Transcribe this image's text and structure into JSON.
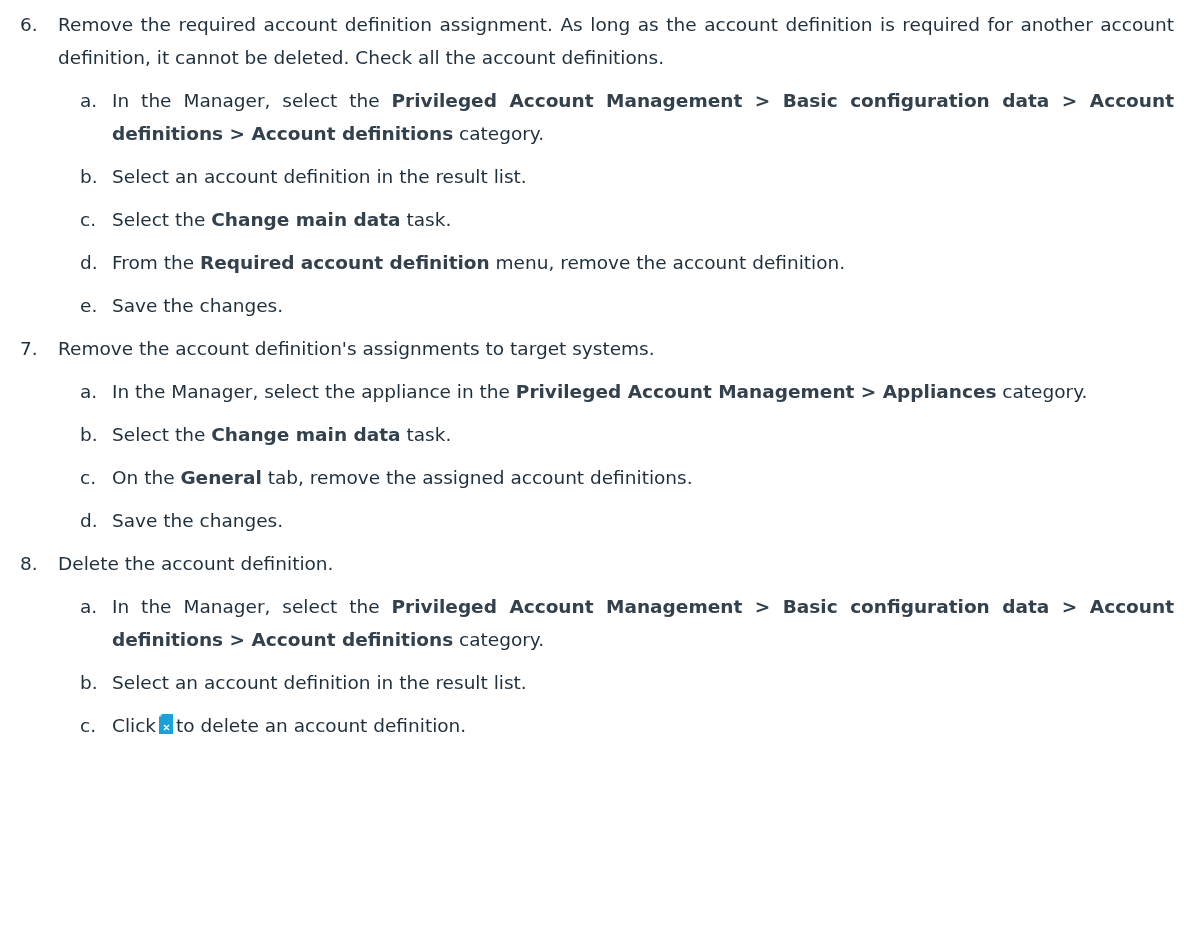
{
  "steps": [
    {
      "number": "6.",
      "text": "Remove the required account definition assignment. As long as the account definition is required for another account definition, it cannot be deleted. Check all the account definitions.",
      "substeps": [
        {
          "letter": "a.",
          "text": "In the Manager, select the **Privileged Account Management > Basic configuration data > Account definitions > Account definitions** category."
        },
        {
          "letter": "b.",
          "text": "Select an account definition in the result list."
        },
        {
          "letter": "c.",
          "text": "Select the **Change main data** task."
        },
        {
          "letter": "d.",
          "text": "From the **Required account definition** menu, remove the account definition."
        },
        {
          "letter": "e.",
          "text": "Save the changes."
        }
      ]
    },
    {
      "number": "7.",
      "text": "Remove the account definition's assignments to target systems.",
      "substeps": [
        {
          "letter": "a.",
          "text": "In the Manager, select the appliance in the **Privileged Account Management > Appliances** category."
        },
        {
          "letter": "b.",
          "text": "Select the **Change main data** task."
        },
        {
          "letter": "c.",
          "text": "On the **General** tab, remove the assigned account definitions."
        },
        {
          "letter": "d.",
          "text": "Save the changes."
        }
      ]
    },
    {
      "number": "8.",
      "text": "Delete the account definition.",
      "substeps": [
        {
          "letter": "a.",
          "text": "In the Manager, select the **Privileged Account Management > Basic configuration data > Account definitions > Account definitions** category."
        },
        {
          "letter": "b.",
          "text": "Select an account definition in the result list."
        },
        {
          "letter": "c.",
          "text": "Click",
          "text_after": "to delete an account definition."
        }
      ]
    }
  ]
}
